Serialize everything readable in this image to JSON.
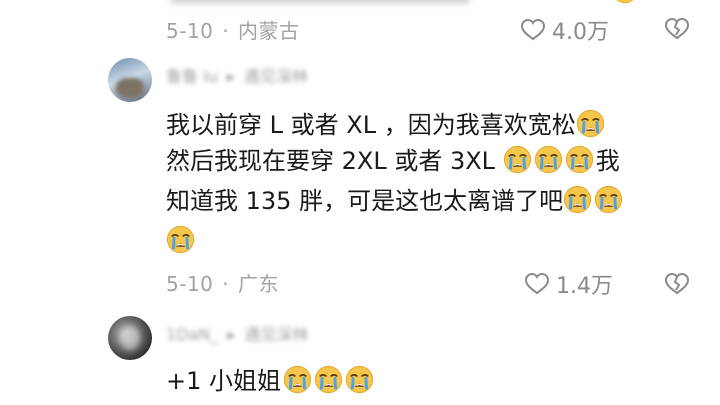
{
  "comments": [
    {
      "date": "5-10",
      "location": "内蒙古",
      "likes": "4.0万"
    },
    {
      "author": "鲁鲁 lu",
      "reply_to": "遇见深林",
      "lines": [
        "我以前穿 L 或者 XL ，因为我喜欢宽松",
        "然后我现在要穿 2XL 或者 3XL ",
        "我",
        "知道我 135 胖，可是这也太离谱了吧",
        ""
      ],
      "date": "5-10",
      "location": "广东",
      "likes": "1.4万"
    },
    {
      "author": "1DaN_",
      "reply_to": "遇见深林",
      "text": "+1 小姐姐"
    }
  ],
  "icons": {
    "like": "heart-outline-icon",
    "dislike": "broken-heart-icon",
    "emoji": "loudly-crying-face-icon",
    "reply_arrow": "triangle-right-icon"
  },
  "colors": {
    "meta_text": "#a3a3a3",
    "body_text": "#1a1a1a",
    "emoji_face": "#f6c64a"
  }
}
